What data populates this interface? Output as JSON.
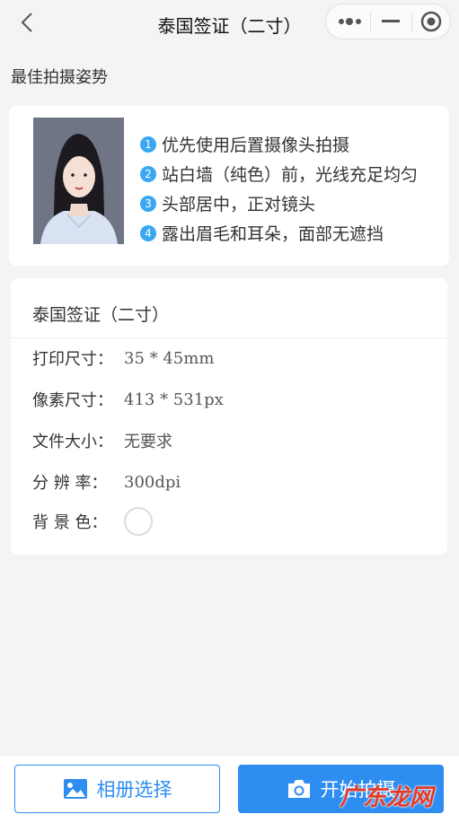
{
  "navbar": {
    "title": "泰国签证（二寸）",
    "back_icon": "chevron-left-icon",
    "more_icon": "more-dots-icon",
    "minimize_icon": "minimize-icon",
    "close_icon": "target-close-icon"
  },
  "pose_section": {
    "label": "最佳拍摄姿势",
    "tips": [
      {
        "num": "1",
        "text": "优先使用后置摄像头拍摄"
      },
      {
        "num": "2",
        "text": "站白墙（纯色）前，光线充足均匀"
      },
      {
        "num": "3",
        "text": "头部居中，正对镜头"
      },
      {
        "num": "4",
        "text": "露出眉毛和耳朵，面部无遮挡"
      }
    ],
    "tip_color": "#3ba7f3"
  },
  "spec": {
    "title": "泰国签证（二寸）",
    "rows": [
      {
        "key": "打印尺寸：",
        "value": "35 * 45mm"
      },
      {
        "key": "像素尺寸：",
        "value": "413 * 531px"
      },
      {
        "key": "文件大小：",
        "value": "无要求"
      },
      {
        "key": "分 辨 率：",
        "value": "300dpi"
      },
      {
        "key": "背 景 色：",
        "value": ""
      }
    ],
    "background_color": "#ffffff"
  },
  "actions": {
    "album_label": "相册选择",
    "album_icon": "image-icon",
    "shoot_label": "开始拍摄",
    "shoot_icon": "camera-icon",
    "accent_color": "#2e8df0"
  },
  "watermark": {
    "text": "广东龙网"
  }
}
